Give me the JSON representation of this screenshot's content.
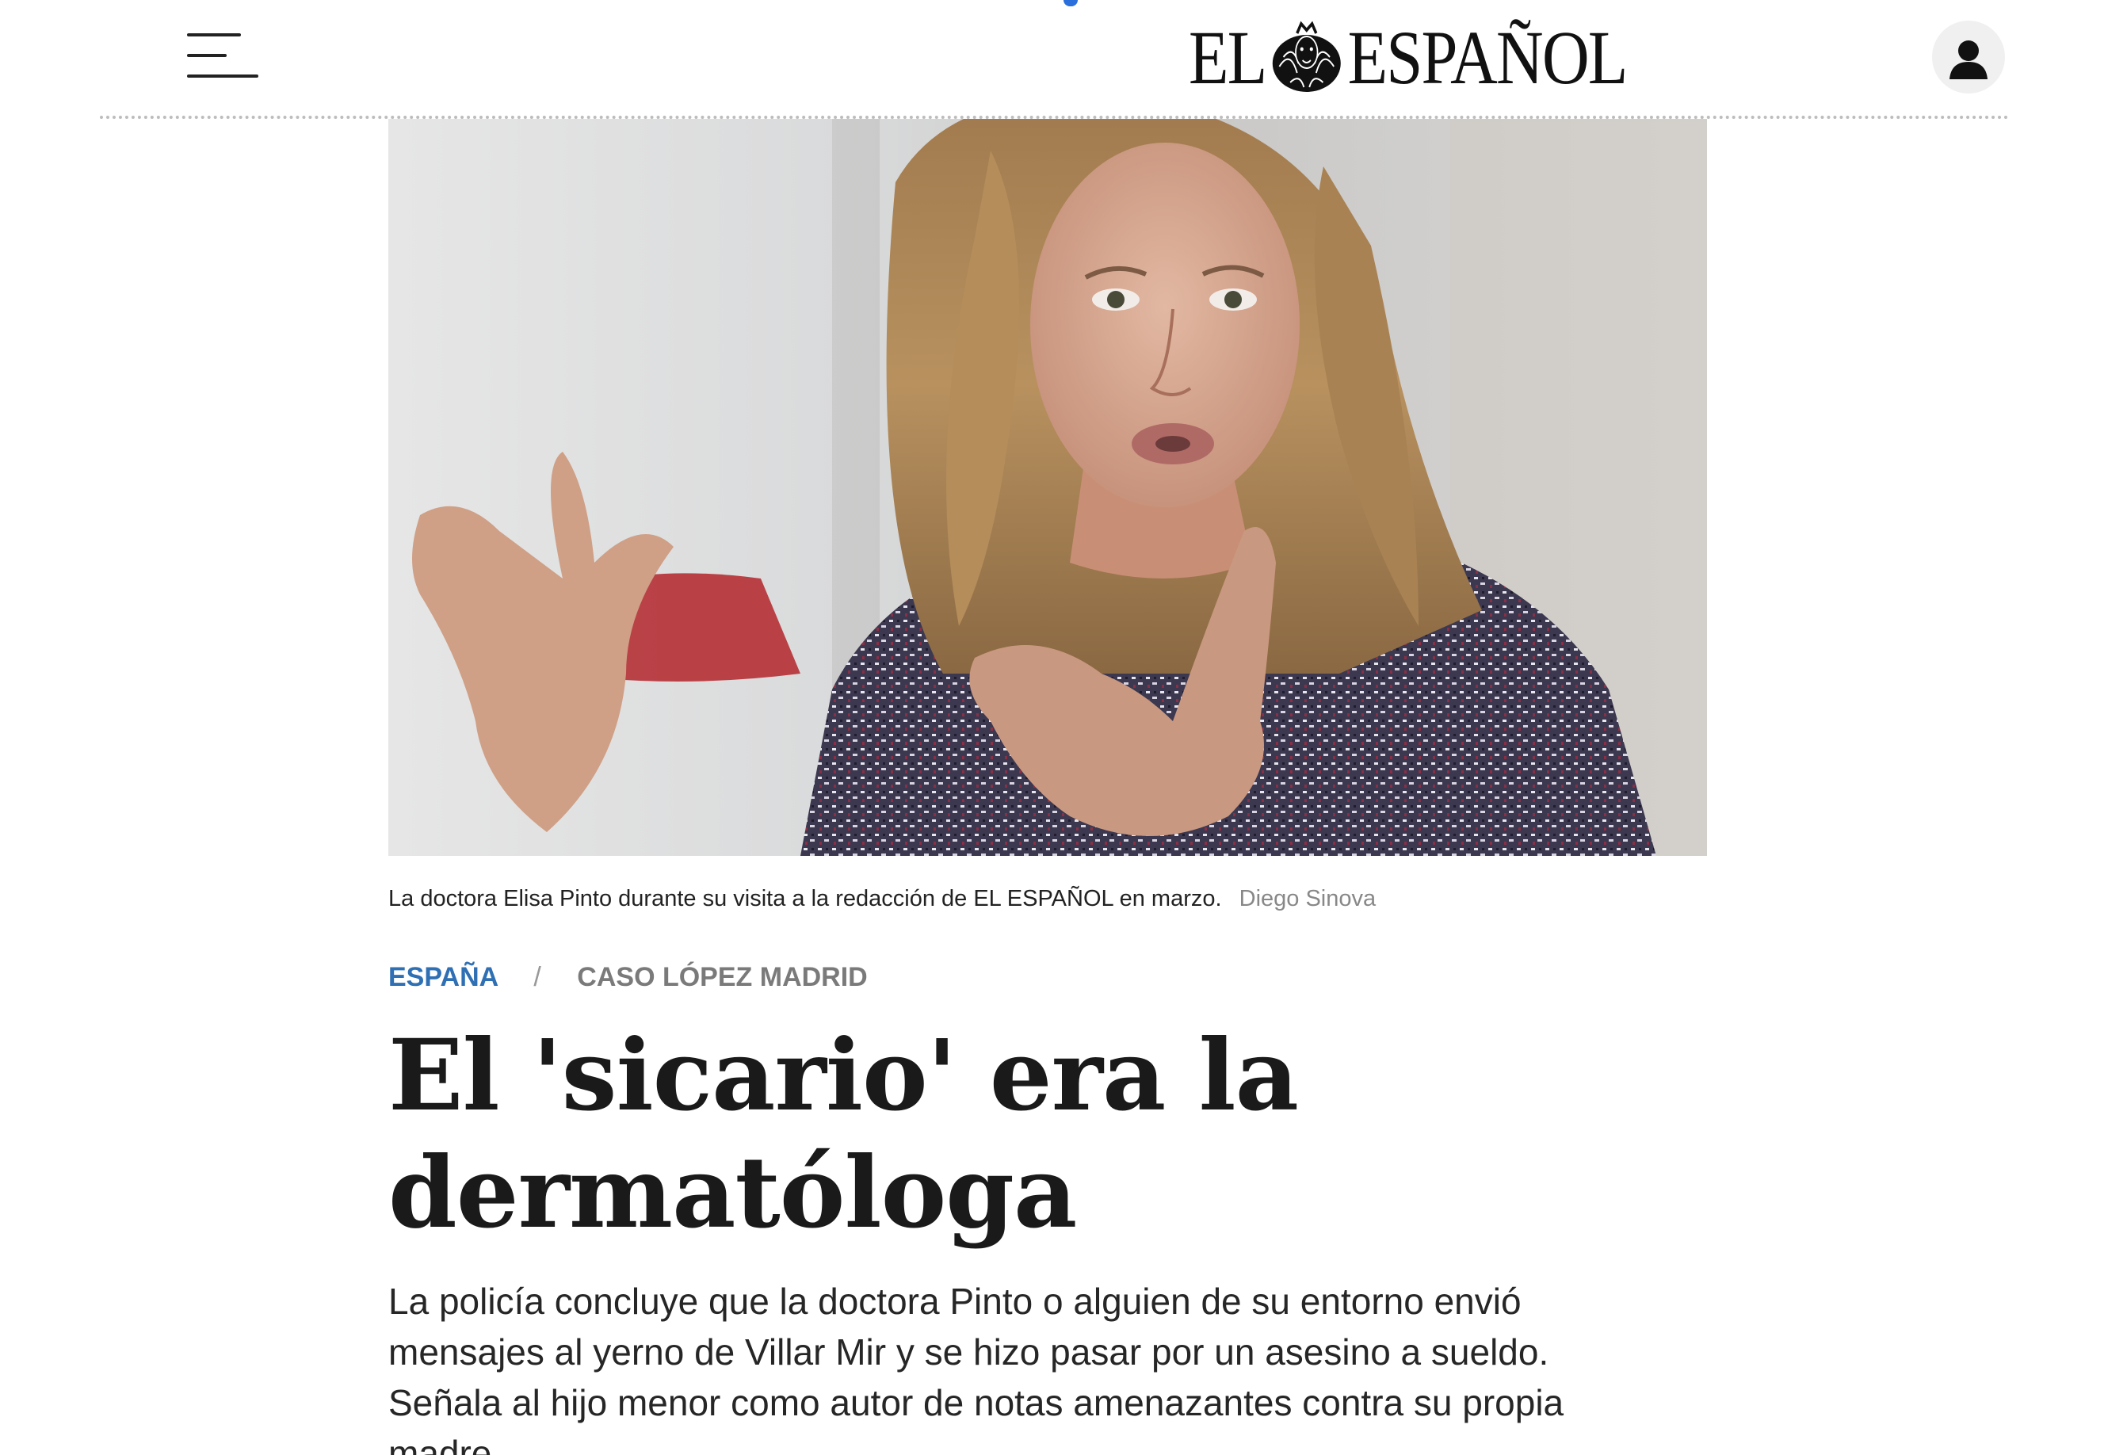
{
  "header": {
    "logo_left": "EL",
    "logo_right": "ESPAÑOL",
    "menu_icon": "hamburger-menu-icon",
    "user_icon": "user-icon",
    "accent_color": "#2a6fdb"
  },
  "hero": {
    "caption": "La doctora Elisa Pinto durante su visita a la redacción de EL ESPAÑOL en marzo.",
    "credit": "Diego Sinova"
  },
  "breadcrumb": {
    "section": "ESPAÑA",
    "separator": "/",
    "topic": "CASO LÓPEZ MADRID",
    "section_color": "#2f6fb3"
  },
  "article": {
    "headline": "El 'sicario' era la dermatóloga",
    "lead": "La policía concluye que la doctora Pinto o alguien de su entorno envió mensajes al yerno de Villar Mir y se hizo pasar por un asesino a sueldo. Señala al hijo menor como autor de notas amenazantes contra su propia madre."
  }
}
